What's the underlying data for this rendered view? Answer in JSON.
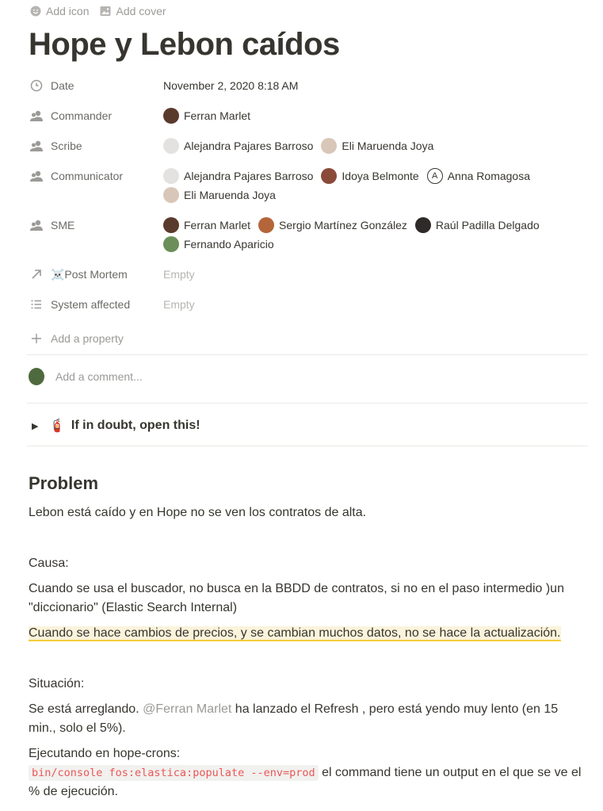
{
  "topbar": {
    "add_icon": "Add icon",
    "add_cover": "Add cover"
  },
  "page": {
    "title": "Hope y Lebon caídos"
  },
  "properties": {
    "date": {
      "name": "Date",
      "icon": "clock-icon",
      "value": "November 2, 2020 8:18 AM"
    },
    "commander": {
      "name": "Commander",
      "icon": "people-icon",
      "people": [
        "Ferran Marlet"
      ]
    },
    "scribe": {
      "name": "Scribe",
      "icon": "people-icon",
      "people": [
        "Alejandra Pajares Barroso",
        "Eli Maruenda Joya"
      ]
    },
    "communicator": {
      "name": "Communicator",
      "icon": "people-icon",
      "people": [
        "Alejandra Pajares Barroso",
        "Idoya Belmonte",
        "Anna Romagosa",
        "Eli Maruenda Joya"
      ]
    },
    "sme": {
      "name": "SME",
      "icon": "people-icon",
      "people": [
        "Ferran Marlet",
        "Sergio Martínez González",
        "Raúl Padilla Delgado",
        "Fernando Aparicio"
      ]
    },
    "post_mortem": {
      "name": "☠️Post Mortem",
      "icon": "arrow-up-right-icon",
      "value": "Empty"
    },
    "system_affected": {
      "name": "System affected",
      "icon": "list-icon",
      "value": "Empty"
    },
    "add_property": "Add a property"
  },
  "comment": {
    "placeholder": "Add a comment..."
  },
  "toggle": {
    "label": "If in doubt, open this!",
    "emoji": "🧯"
  },
  "content": {
    "heading": "Problem",
    "p1": "Lebon está caído y en Hope no se ven los contratos de alta.",
    "causa_label": "Causa:",
    "causa_text": "Cuando se usa el buscador, no busca en la BBDD de contratos, si no en el paso intermedio )un \"diccionario\" (Elastic Search Internal)",
    "highlight": "Cuando se hace cambios de precios, y se cambian muchos datos, no se hace la actualización.",
    "situacion_label": "Situación:",
    "sit_pre": "Se está arreglando. ",
    "sit_mention": "@Ferran Marlet",
    "sit_post": " ha lanzado el Refresh , pero está yendo muy lento (en 15 min., solo el 5%).",
    "exec_label": "Ejecutando en hope-crons:",
    "code": "bin/console fos:elastica:populate --env=prod",
    "exec_post": " el command tiene un output en el que se ve el % de ejecución."
  },
  "colors": {
    "text": "#37352f",
    "muted": "#9b9a97",
    "highlight_bg": "#fbf3db",
    "highlight_line": "#f5cc3c",
    "code": "#eb5757"
  }
}
